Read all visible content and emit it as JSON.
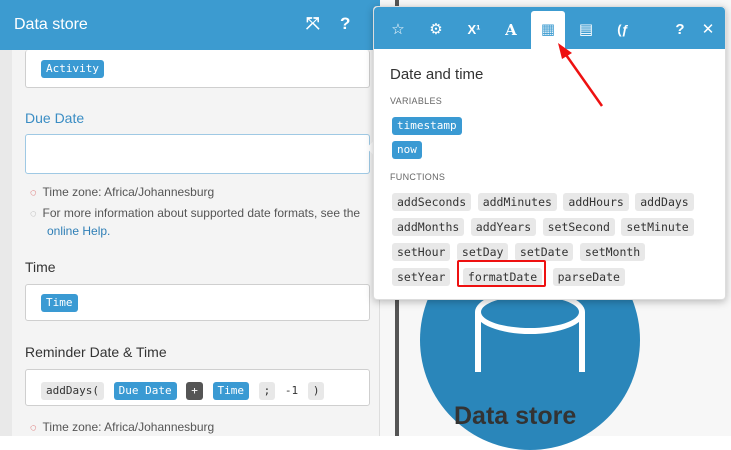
{
  "panel": {
    "title": "Data store",
    "header_icons": [
      "expand-icon",
      "help-icon",
      "close-icon"
    ],
    "header_expand_glyph": "⤧",
    "header_help_glyph": "?",
    "header_close_glyph": "✕",
    "activity_pill": "Activity",
    "due_date_label": "Due Date",
    "due_date_value": "",
    "timezone_note": "Time zone: Africa/Johannesburg",
    "info_note": "For more information about supported date formats, see the",
    "info_link": "online Help.",
    "time_label": "Time",
    "time_pill": "Time",
    "reminder_label": "Reminder Date & Time",
    "reminder_formula": {
      "fn_open": "addDays(",
      "arg1": "Due Date",
      "plus": "+",
      "arg2": "Time",
      "sep": ";",
      "num": "-1",
      "close": ")"
    },
    "timezone_note_2": "Time zone: Africa/Johannesburg"
  },
  "popup": {
    "tabs": [
      {
        "name": "star-icon",
        "glyph": "☆"
      },
      {
        "name": "gear-icon",
        "glyph": "⚙"
      },
      {
        "name": "superscript-icon",
        "glyph": "X¹"
      },
      {
        "name": "text-icon",
        "glyph": "A"
      },
      {
        "name": "calendar-icon",
        "glyph": "▦"
      },
      {
        "name": "table-icon",
        "glyph": "▤"
      },
      {
        "name": "function-icon",
        "glyph": "(ƒ"
      },
      {
        "name": "help-icon",
        "glyph": "?"
      },
      {
        "name": "close-icon",
        "glyph": "✕"
      }
    ],
    "title": "Date and time",
    "variables_label": "VARIABLES",
    "variables": [
      "timestamp",
      "now"
    ],
    "functions_label": "FUNCTIONS",
    "functions": [
      [
        "addSeconds",
        "addMinutes",
        "addHours",
        "addDays"
      ],
      [
        "addMonths",
        "addYears",
        "setSecond",
        "setMinute"
      ],
      [
        "setHour",
        "setDay",
        "setDate",
        "setMonth"
      ],
      [
        "setYear",
        "formatDate",
        "parseDate"
      ]
    ],
    "highlighted_function": "formatDate"
  },
  "canvas": {
    "module_label": "Data store"
  },
  "colors": {
    "header_blue": "#3c9bd0",
    "pill_blue": "#3a9ad3",
    "highlight_red": "#ee1111"
  }
}
